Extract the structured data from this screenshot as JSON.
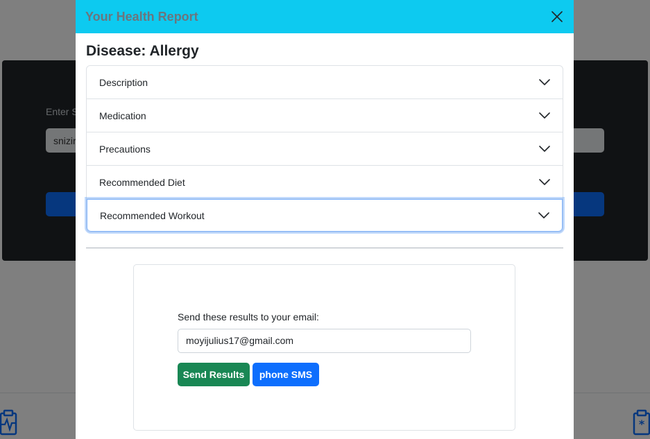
{
  "background": {
    "label_partial": "Enter S",
    "input_partial": "snizir"
  },
  "modal": {
    "title": "Your Health Report",
    "disease_heading": "Disease: Allergy",
    "accordion": [
      {
        "label": "Description"
      },
      {
        "label": "Medication"
      },
      {
        "label": "Precautions"
      },
      {
        "label": "Recommended Diet"
      },
      {
        "label": "Recommended Workout"
      }
    ],
    "email_form": {
      "label": "Send these results to your email:",
      "email_value": "moyijulius17@gmail.com",
      "send_button": "Send Results",
      "sms_button": "phone SMS"
    }
  },
  "colors": {
    "header_bg": "#0dcaf0",
    "send_button": "#198754",
    "sms_button": "#0d6efd"
  }
}
